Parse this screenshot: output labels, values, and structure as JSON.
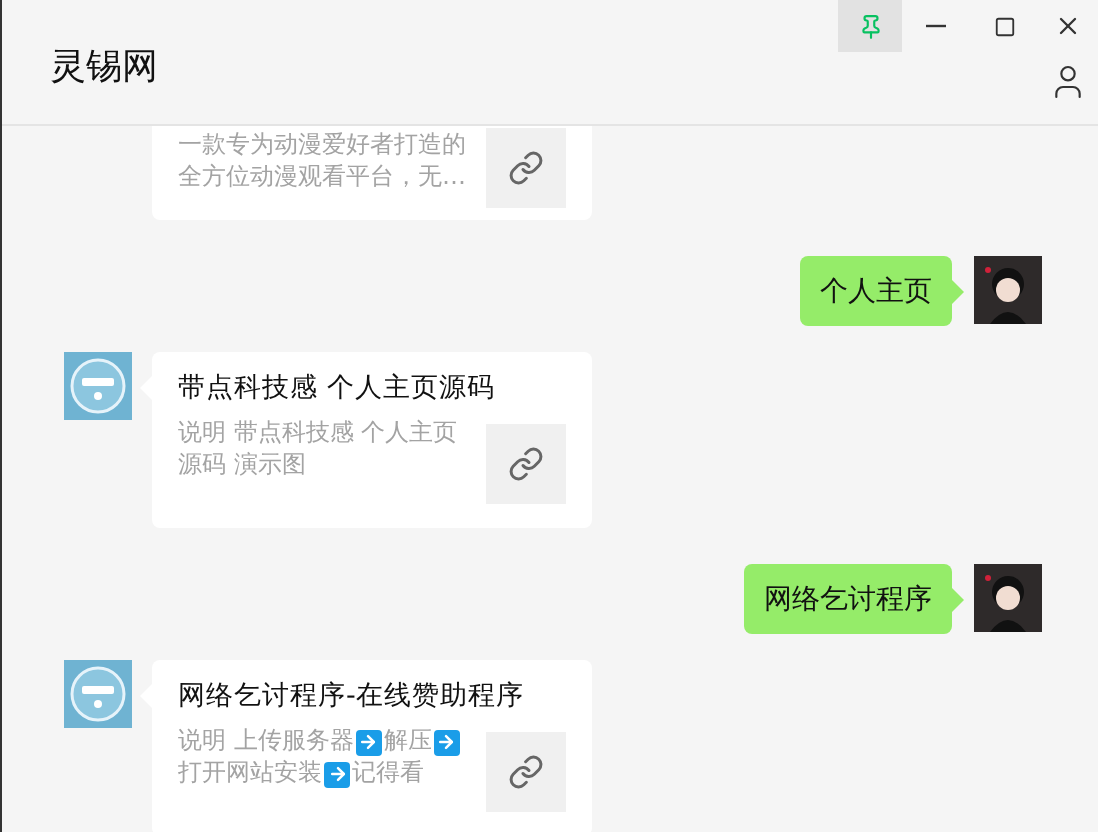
{
  "window": {
    "title": "灵锡网"
  },
  "messages": [
    {
      "kind": "card",
      "description": [
        {
          "kind": "text",
          "text": "一款专为动漫爱好者打造的全方位动漫观看平台，无…"
        }
      ]
    },
    {
      "kind": "text",
      "text": "个人主页"
    },
    {
      "kind": "card",
      "title": "带点科技感 个人主页源码",
      "description": [
        {
          "kind": "text",
          "text": "说明 带点科技感 个人主页源码 演示图"
        }
      ]
    },
    {
      "kind": "text",
      "text": "网络乞讨程序"
    },
    {
      "kind": "card",
      "title": "网络乞讨程序-在线赞助程序",
      "description": [
        {
          "kind": "text",
          "text": "说明  上传服务器"
        },
        {
          "kind": "arrow"
        },
        {
          "kind": "text",
          "text": "解压"
        },
        {
          "kind": "arrow"
        },
        {
          "kind": "text",
          "text": "打开网站安装"
        },
        {
          "kind": "arrow"
        },
        {
          "kind": "text",
          "text": "记得看"
        }
      ]
    }
  ]
}
